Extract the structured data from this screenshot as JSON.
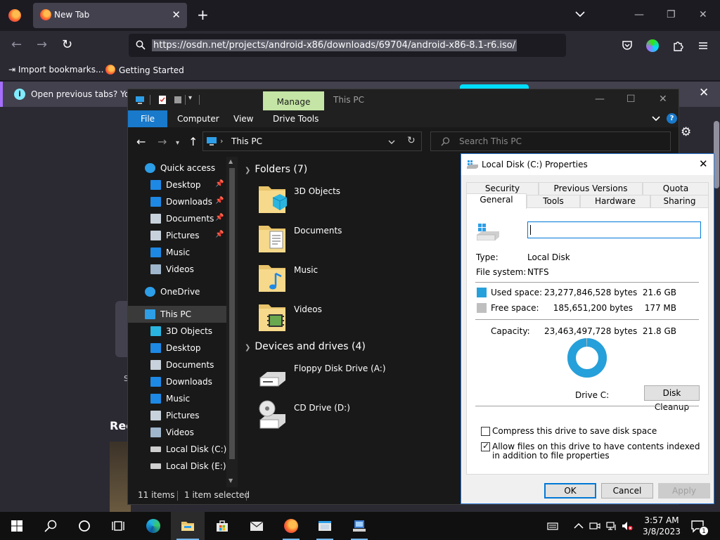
{
  "firefox": {
    "tab_title": "New Tab",
    "url": "https://osdn.net/projects/android-x86/downloads/69704/android-x86-8.1-r6.iso/",
    "bookmarks": [
      "Import bookmarks...",
      "Getting Started"
    ],
    "notice_text": "Open previous tabs? You c",
    "recent_heading": "Rec",
    "partial_s": "S"
  },
  "explorer": {
    "ribbon_context_tab": "Manage",
    "window_title": "This PC",
    "ribbon_tabs": [
      "File",
      "Computer",
      "View",
      "Drive Tools"
    ],
    "address": "This PC",
    "search_placeholder": "Search This PC",
    "nav_items": [
      {
        "label": "Quick access",
        "icon": "star-icon"
      },
      {
        "label": "Desktop",
        "icon": "desktop-folder-icon",
        "pinned": true
      },
      {
        "label": "Downloads",
        "icon": "downloads-folder-icon",
        "pinned": true
      },
      {
        "label": "Documents",
        "icon": "documents-folder-icon",
        "pinned": true
      },
      {
        "label": "Pictures",
        "icon": "pictures-folder-icon",
        "pinned": true
      },
      {
        "label": "Music",
        "icon": "music-folder-icon"
      },
      {
        "label": "Videos",
        "icon": "videos-folder-icon"
      },
      {
        "label": "OneDrive",
        "icon": "onedrive-cloud-icon"
      },
      {
        "label": "This PC",
        "icon": "this-pc-icon",
        "selected": true
      },
      {
        "label": "3D Objects",
        "icon": "3d-objects-folder-icon"
      },
      {
        "label": "Desktop",
        "icon": "desktop-folder-icon"
      },
      {
        "label": "Documents",
        "icon": "documents-folder-icon"
      },
      {
        "label": "Downloads",
        "icon": "downloads-folder-icon"
      },
      {
        "label": "Music",
        "icon": "music-folder-icon"
      },
      {
        "label": "Pictures",
        "icon": "pictures-folder-icon"
      },
      {
        "label": "Videos",
        "icon": "videos-folder-icon"
      },
      {
        "label": "Local Disk (C:)",
        "icon": "local-disk-icon"
      },
      {
        "label": "Local Disk (E:)",
        "icon": "local-disk-icon"
      }
    ],
    "folders_header": "Folders (7)",
    "folders": [
      "3D Objects",
      "Documents",
      "Music",
      "Videos"
    ],
    "devices_header": "Devices and drives (4)",
    "devices": [
      "Floppy Disk Drive (A:)",
      "CD Drive (D:)"
    ],
    "status_items": "11 items",
    "status_selected": "1 item selected"
  },
  "properties": {
    "title": "Local Disk (C:) Properties",
    "tabs_row1": [
      "Security",
      "Previous Versions",
      "Quota"
    ],
    "tabs_row2": [
      "General",
      "Tools",
      "Hardware",
      "Sharing"
    ],
    "active_tab": "General",
    "volume_label": "",
    "type_label": "Type:",
    "type_value": "Local Disk",
    "fs_label": "File system:",
    "fs_value": "NTFS",
    "used_label": "Used space:",
    "used_bytes": "23,277,846,528 bytes",
    "used_gb": "21.6 GB",
    "free_label": "Free space:",
    "free_bytes": "185,651,200 bytes",
    "free_mb": "177 MB",
    "capacity_label": "Capacity:",
    "capacity_bytes": "23,463,497,728 bytes",
    "capacity_gb": "21.8 GB",
    "used_fraction": 0.992,
    "drive_caption": "Drive C:",
    "cleanup_label": "Disk Cleanup",
    "compress_label": "Compress this drive to save disk space",
    "compress_checked": false,
    "index_label": "Allow files on this drive to have contents indexed in addition to file properties",
    "index_checked": true,
    "ok_label": "OK",
    "cancel_label": "Cancel",
    "apply_label": "Apply",
    "colors": {
      "used": "#26a0da",
      "free": "#bfbfbf"
    }
  },
  "taskbar": {
    "time": "3:57 AM",
    "date": "3/8/2023",
    "notification_count": "1"
  }
}
